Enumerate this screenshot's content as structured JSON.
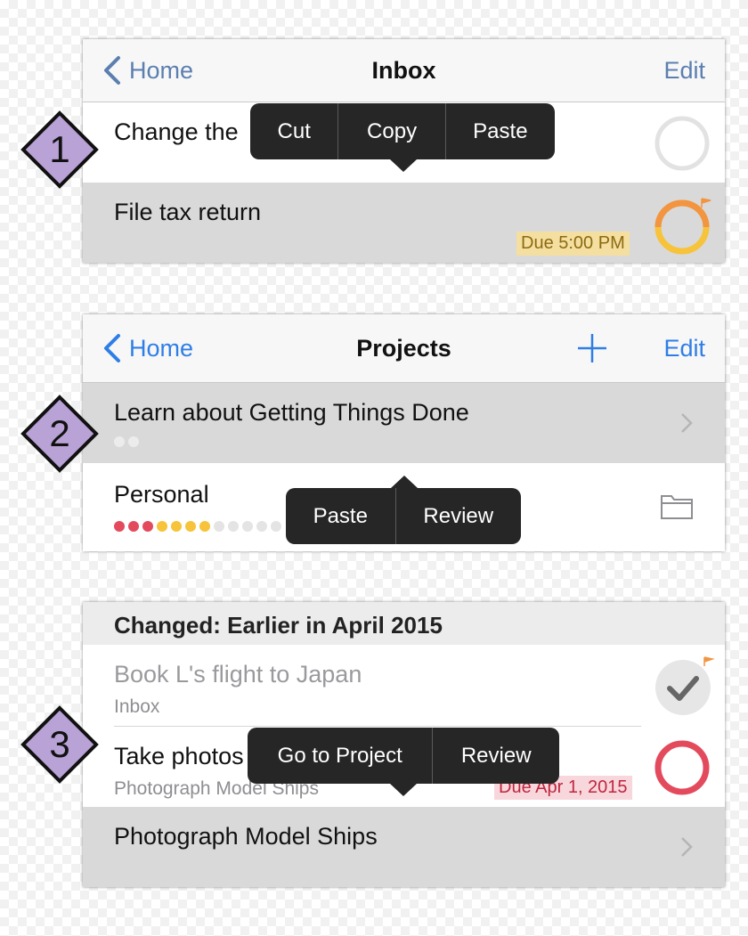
{
  "colors": {
    "accent": "#5b7fb0",
    "blue": "#2f7ee6",
    "badge_fill": "#b8a2d6",
    "due_today_bg": "#f5dfa0",
    "due_today_text": "#8b6a12",
    "due_overdue_bg": "#f8d7dc",
    "due_overdue_text": "#c0263f",
    "ring_orange": "#f29440",
    "ring_yellow": "#f6c33a",
    "ring_red": "#e34b5d",
    "dot_red": "#e34b5d",
    "dot_yellow": "#f6c33a",
    "dot_gray": "#e4e4e4"
  },
  "panel1": {
    "badge": "1",
    "nav": {
      "back": "Home",
      "title": "Inbox",
      "edit": "Edit"
    },
    "rows": [
      {
        "title": "Change the",
        "icon": "empty-circle-icon"
      },
      {
        "title": "File tax return",
        "due": "Due 5:00 PM",
        "icon": "due-soon-ring-icon"
      }
    ],
    "menu": [
      "Cut",
      "Copy",
      "Paste"
    ]
  },
  "panel2": {
    "badge": "2",
    "nav": {
      "back": "Home",
      "title": "Projects",
      "add": "plus-icon",
      "edit": "Edit"
    },
    "rows": [
      {
        "title": "Learn about Getting Things Done",
        "icon": "chevron-right-icon"
      },
      {
        "title": "Personal",
        "icon": "folder-icon"
      }
    ],
    "menu": [
      "Paste",
      "Review"
    ]
  },
  "panel3": {
    "badge": "3",
    "section_header": "Changed: Earlier in April 2015",
    "rows": [
      {
        "title": "Book L's flight to Japan",
        "subtitle": "Inbox",
        "icon": "completed-check-icon"
      },
      {
        "title": "Take photos",
        "subtitle": "Photograph Model Ships",
        "due": "Due Apr 1, 2015",
        "icon": "overdue-ring-icon"
      },
      {
        "title": "Photograph Model Ships",
        "icon": "chevron-right-icon"
      }
    ],
    "menu": [
      "Go to Project",
      "Review"
    ]
  }
}
